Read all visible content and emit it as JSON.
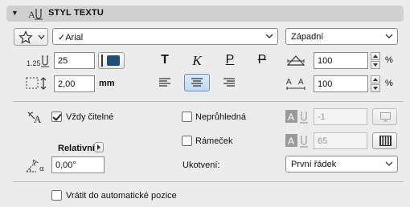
{
  "header": {
    "title": "STYL TEXTU"
  },
  "font": {
    "name": "Arial",
    "check_mark": "✓"
  },
  "script": {
    "value": "Západní"
  },
  "size": {
    "value": "25"
  },
  "color": {
    "swatch": "#1f4e79"
  },
  "spacing": {
    "value": "2,00",
    "unit": "mm"
  },
  "format_buttons": [
    {
      "label": "T"
    },
    {
      "label": "K"
    },
    {
      "label": "P"
    },
    {
      "label": "P"
    }
  ],
  "width_factor": {
    "value": "100",
    "unit": "%"
  },
  "char_spacing": {
    "value": "100",
    "unit": "%"
  },
  "always_readable": {
    "label": "Vždy čitelné",
    "checked": true
  },
  "relative": {
    "label": "Relativní"
  },
  "angle": {
    "value": "0,00°"
  },
  "opaque": {
    "label": "Neprůhledná",
    "checked": false
  },
  "frame": {
    "label": "Rámeček",
    "checked": false
  },
  "pen1": {
    "value": "-1"
  },
  "pen2": {
    "value": "65"
  },
  "anchor": {
    "label": "Ukotvení:",
    "value": "První řádek"
  },
  "reset": {
    "label": "Vrátit do automatické pozice",
    "checked": false
  },
  "icons": {
    "header": "text-style-icon",
    "favorites": "star-icon",
    "size": "text-size-icon",
    "spacing": "line-spacing-icon",
    "width": "width-factor-icon",
    "charspace": "char-spacing-icon",
    "readable": "readable-text-icon",
    "angle": "rotation-angle-icon"
  }
}
